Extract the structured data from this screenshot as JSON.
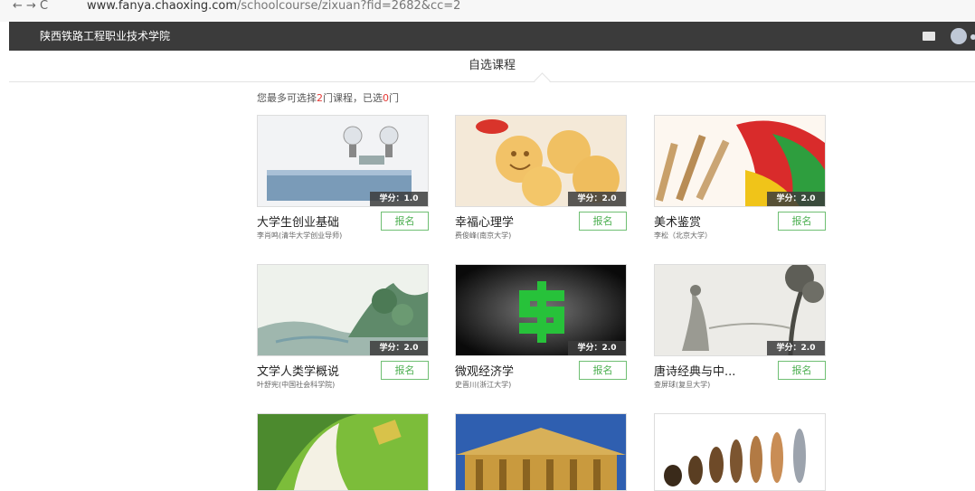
{
  "browser": {
    "url_host": "www.fanya.chaoxing.com",
    "url_path": "/schoolcourse/zixuan?fid=2682&cc=2",
    "nav_glyphs": "←  →  C"
  },
  "header": {
    "school_name": "陕西铁路工程职业技术学院",
    "icons": [
      "mail-icon",
      "avatar"
    ]
  },
  "tab": {
    "label": "自选课程"
  },
  "notice": {
    "prefix": "您最多可选择",
    "max": "2",
    "middle": "门课程，已选",
    "selected": "0",
    "suffix": "门"
  },
  "courses": [
    {
      "title": "大学生创业基础",
      "teacher": "李肖鸣(清华大学创业导师)",
      "credit": "学分：1.0",
      "button": "报名"
    },
    {
      "title": "幸福心理学",
      "teacher": "费俊峰(南京大学)",
      "credit": "学分：2.0",
      "button": "报名"
    },
    {
      "title": "美术鉴赏",
      "teacher": "李松（北京大学）",
      "credit": "学分：2.0",
      "button": "报名"
    },
    {
      "title": "文学人类学概说",
      "teacher": "叶舒宪(中国社会科学院)",
      "credit": "学分：2.0",
      "button": "报名"
    },
    {
      "title": "微观经济学",
      "teacher": "史晋川(浙江大学)",
      "credit": "学分：2.0",
      "button": "报名"
    },
    {
      "title": "唐诗经典与中...",
      "teacher": "查屏球(复旦大学)",
      "credit": "学分：2.0",
      "button": "报名"
    }
  ]
}
